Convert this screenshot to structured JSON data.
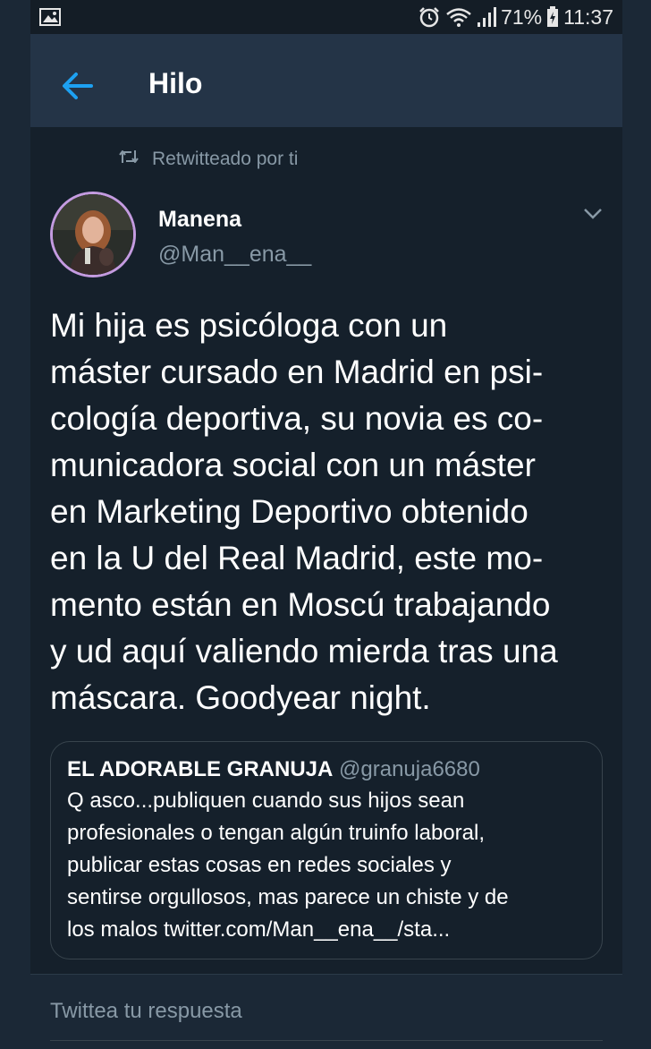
{
  "status_bar": {
    "battery": "71%",
    "time": "11:37"
  },
  "header": {
    "title": "Hilo"
  },
  "retweet": {
    "label": "Retwitteado por ti"
  },
  "tweet": {
    "author_name": "Manena",
    "author_handle": "@Man__ena__",
    "text_lines": [
      "Mi hija es psicóloga con un",
      "máster cursado en Madrid en psi-",
      "cología deportiva, su novia es co-",
      "municadora social con un máster",
      "en Marketing Deportivo obtenido",
      "en la U del Real Madrid, este mo-",
      "mento están en Moscú trabajando",
      "y ud aquí valiendo mierda tras una",
      "máscara. Goodyear night."
    ]
  },
  "quoted_tweet": {
    "author_name": "EL ADORABLE GRANUJA",
    "author_handle": "@granuja6680",
    "text_lines": [
      "Q asco...publiquen cuando sus hijos sean",
      "profesionales o tengan algún truinfo laboral,",
      "publicar estas cosas en redes sociales y",
      "sentirse orgullosos, mas parece un chiste y de",
      "los malos twitter.com/Man__ena__/sta..."
    ]
  },
  "reply": {
    "placeholder": "Twittea tu respuesta"
  },
  "colors": {
    "background": "#15202b",
    "header": "#243447",
    "accent": "#1da1f2",
    "secondary_text": "#8899a6",
    "avatar_ring": "#c49be0"
  }
}
